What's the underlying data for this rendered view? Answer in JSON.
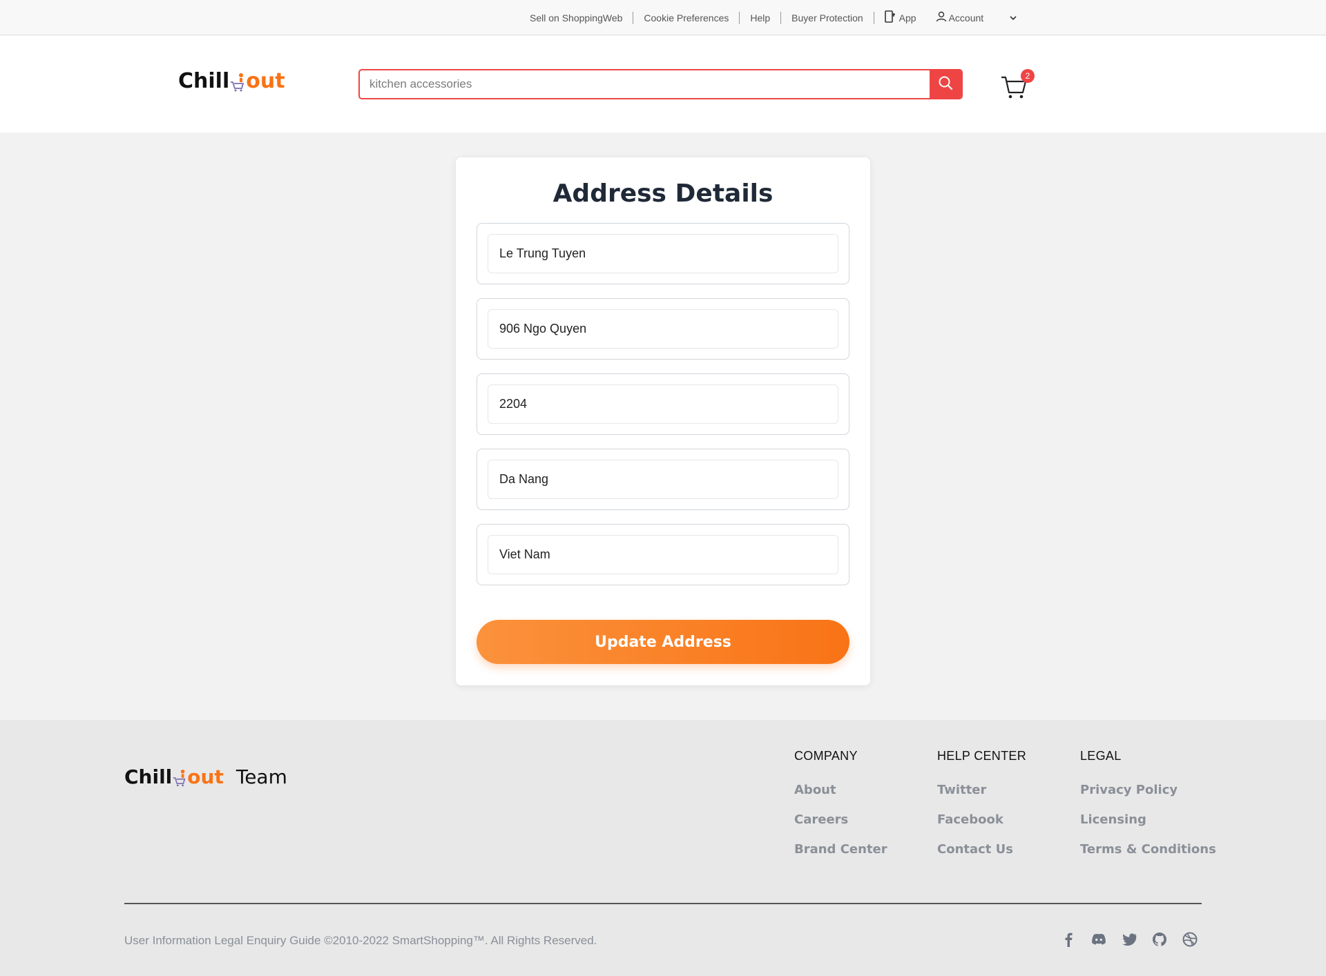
{
  "topbar": {
    "links": [
      "Sell on ShoppingWeb",
      "Cookie Preferences",
      "Help",
      "Buyer Protection"
    ],
    "app_label": "App",
    "account_label": "Account"
  },
  "header": {
    "logo_chill": "Chill",
    "logo_out": "out",
    "search_placeholder": "kitchen accessories",
    "cart_count": "2"
  },
  "form": {
    "title": "Address Details",
    "fields": [
      "Le Trung Tuyen",
      "906 Ngo Quyen",
      "2204",
      "Da Nang",
      "Viet Nam"
    ],
    "submit_label": "Update Address"
  },
  "footer": {
    "logo_chill": "Chill",
    "logo_out": "out",
    "logo_team": "Team",
    "columns": [
      {
        "heading": "COMPANY",
        "links": [
          "About",
          "Careers",
          "Brand Center"
        ]
      },
      {
        "heading": "HELP CENTER",
        "links": [
          "Twitter",
          "Facebook",
          "Contact Us"
        ]
      },
      {
        "heading": "LEGAL",
        "links": [
          "Privacy Policy",
          "Licensing",
          "Terms & Conditions"
        ]
      }
    ],
    "copyright": "User Information Legal Enquiry Guide ©2010-2022 SmartShopping™. All Rights Reserved.",
    "social_icons": [
      "facebook-icon",
      "discord-icon",
      "twitter-icon",
      "github-icon",
      "dribbble-icon"
    ]
  },
  "colors": {
    "accent_orange": "#f97316",
    "accent_red": "#ef4444"
  }
}
